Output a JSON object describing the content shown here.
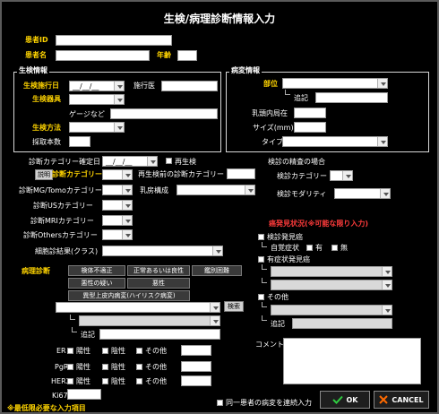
{
  "window": {
    "title": "生検/病理診断情報入力"
  },
  "patient": {
    "id_label": "患者ID",
    "name_label": "患者名",
    "age_label": "年齢"
  },
  "biopsy": {
    "legend": "生検情報",
    "date_label": "生検施行日",
    "date_value": "__/__/__",
    "operator_label": "施行医",
    "device_label": "生検器具",
    "gauge_label": "ゲージなど",
    "method_label": "生検方法",
    "samples_label": "採取本数"
  },
  "lesion": {
    "legend": "病変情報",
    "site_label": "部位",
    "note_prefix": "追記",
    "distance_label": "乳頭内局在",
    "size_label": "サイズ(mm)",
    "type_label": "タイプ"
  },
  "diagnosis": {
    "category_date_label": "診断カテゴリー確定日",
    "category_date_value": "__/__/__",
    "rebiopsy_label": "再生検",
    "explain_button": "説明",
    "category_label": "診断カテゴリー",
    "pre_rebiopsy_label": "再生検前の診断カテゴリー",
    "mg_label": "診断MG/Tomoカテゴリー",
    "breast_comp_label": "乳房構成",
    "us_label": "診断USカテゴリー",
    "mri_label": "診断MRIカテゴリー",
    "others_label": "診断Othersカテゴリー",
    "cytology_label": "細胞診結果(クラス)"
  },
  "precision": {
    "legend": "検診の精査の場合",
    "exam_category_label": "検診カテゴリー",
    "exam_modality_label": "検診モダリティ"
  },
  "pathology": {
    "label": "病理診断",
    "buttons": [
      "検体不適正",
      "正常あるいは良性",
      "鑑別困難",
      "悪性の疑い",
      "悪性",
      "異型上皮内病変(ハイリスク病変)"
    ],
    "search_button": "検索",
    "note_prefix": "追記"
  },
  "discovery": {
    "title": "癌発見状況(※可能な限り入力)",
    "screening_label": "検診発見癌",
    "self_symptom_label": "自覚症状",
    "yes_label": "有",
    "no_label": "無",
    "followup_label": "有症状発見癌",
    "other_label": "その他",
    "note_prefix": "追記"
  },
  "markers": {
    "rows": [
      {
        "name": "ER"
      },
      {
        "name": "PgR"
      },
      {
        "name": "HER2"
      }
    ],
    "negative": "陽性",
    "positive": "陰性",
    "other": "その他",
    "ki67_label": "Ki67"
  },
  "comment_label": "コメント",
  "footer": {
    "required_note": "※最低限必要な入力項目",
    "same_patient_label": "同一患者の病変を連続入力",
    "ok_label": "OK",
    "cancel_label": "CANCEL"
  },
  "colors": {
    "required": "#ffd400",
    "warning": "#ff3b3b",
    "ok_icon": "#2ecc40",
    "cancel_icon": "#ff6a00"
  }
}
